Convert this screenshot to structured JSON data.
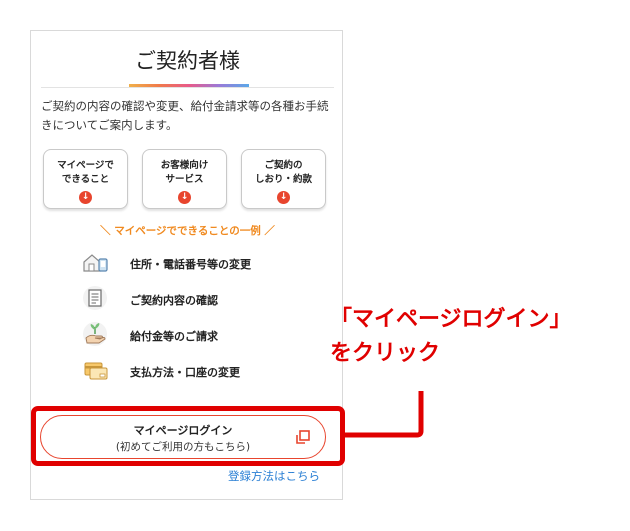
{
  "panel": {
    "title": "ご契約者様",
    "intro": "ご契約の内容の確認や変更、給付金請求等の各種お手続きについてご案内します。",
    "cards": [
      {
        "label": "マイページで\nできること"
      },
      {
        "label": "お客様向け\nサービス"
      },
      {
        "label": "ご契約の\nしおり・約款"
      }
    ],
    "example_heading": "＼ マイページでできることの一例 ／",
    "features": [
      {
        "label": "住所・電話番号等の変更",
        "icon": "house-phone-icon"
      },
      {
        "label": "ご契約内容の確認",
        "icon": "document-icon"
      },
      {
        "label": "給付金等のご請求",
        "icon": "hand-plant-icon"
      },
      {
        "label": "支払方法・口座の変更",
        "icon": "card-icon"
      }
    ],
    "login_button": {
      "line1": "マイページログイン",
      "line2": "(初めてご利用の方もこちら)"
    },
    "register_link": "登録方法はこちら"
  },
  "annotation": {
    "line1": "「マイページログイン」",
    "line2": "をクリック"
  },
  "colors": {
    "accent": "#e8452e",
    "annotation": "#e00000",
    "heading": "#f08a20",
    "link": "#2a7fd4"
  }
}
